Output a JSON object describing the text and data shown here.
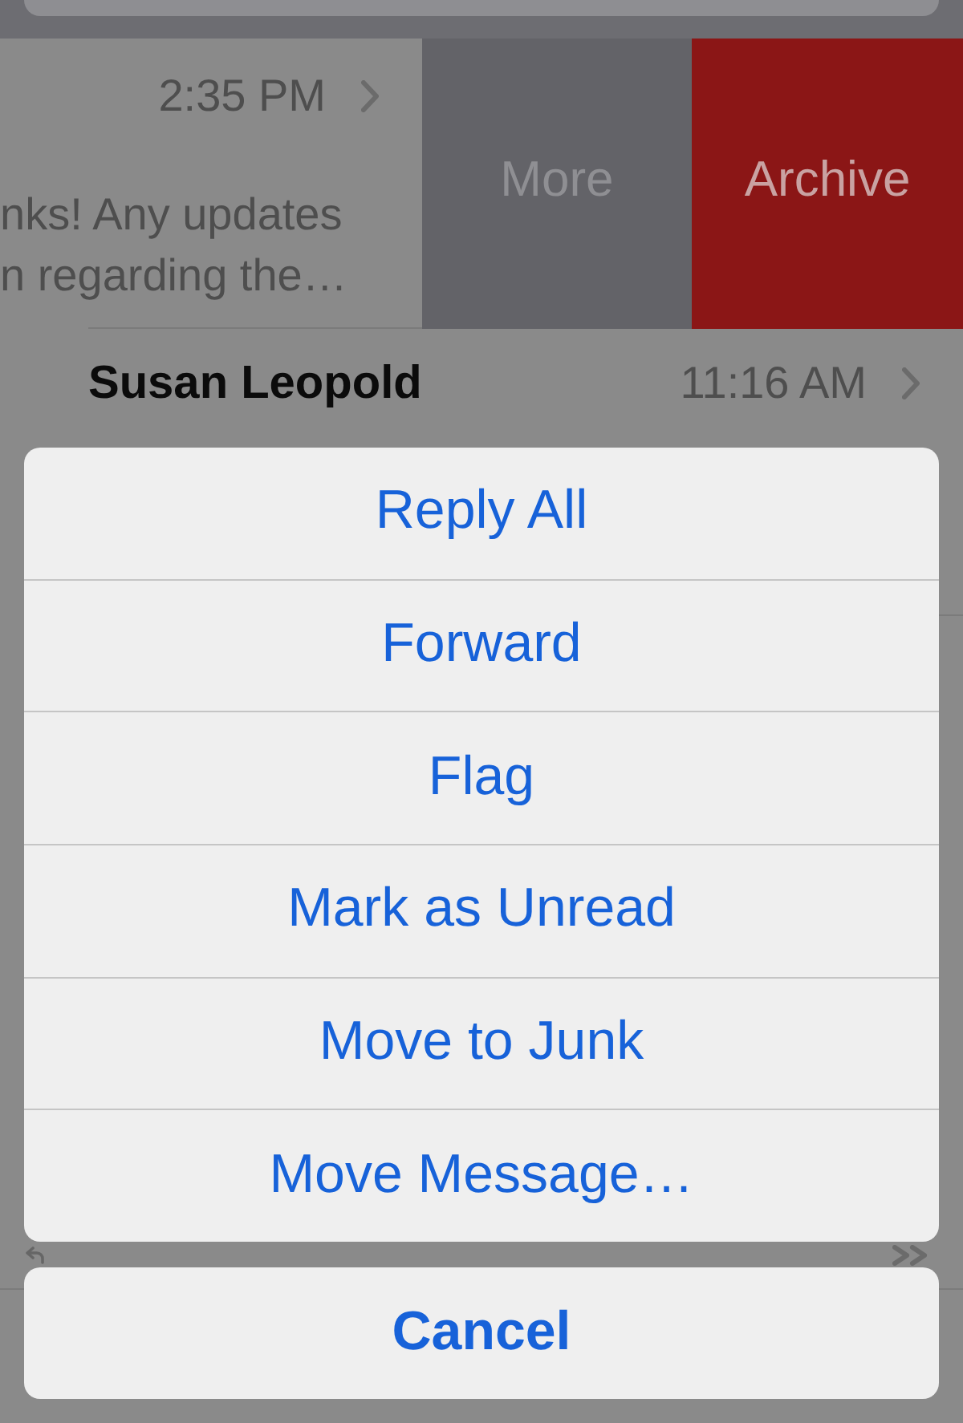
{
  "message_list": {
    "rows": [
      {
        "time": "2:35 PM",
        "preview_lines": [
          "nks! Any updates",
          "n regarding the…"
        ],
        "swipe_actions": [
          {
            "label": "More",
            "kind": "more"
          },
          {
            "label": "Archive",
            "kind": "archive"
          }
        ]
      },
      {
        "sender": "Susan Leopold",
        "time": "11:16 AM"
      }
    ]
  },
  "action_sheet": {
    "actions": [
      "Reply All",
      "Forward",
      "Flag",
      "Mark as Unread",
      "Move to Junk",
      "Move Message…"
    ],
    "cancel": "Cancel"
  }
}
